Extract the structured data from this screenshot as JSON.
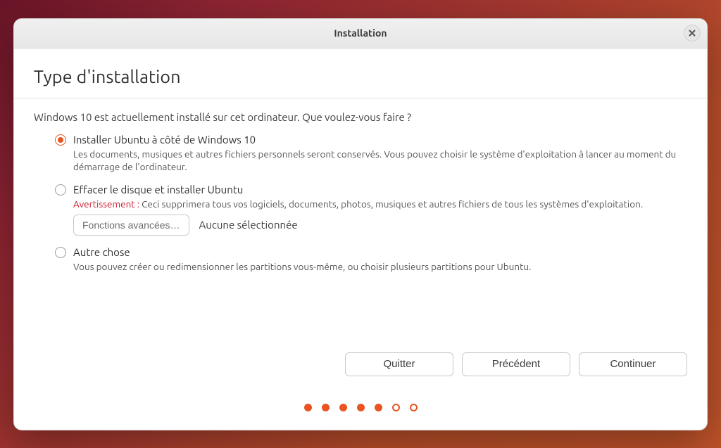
{
  "titlebar": {
    "title": "Installation"
  },
  "page_title": "Type d'installation",
  "prompt": "Windows 10 est actuellement installé sur cet ordinateur. Que voulez-vous faire ?",
  "options": [
    {
      "id": "alongside",
      "title": "Installer Ubuntu à côté de Windows 10",
      "description": "Les documents, musiques et autres fichiers personnels seront conservés. Vous pouvez choisir le système d'exploitation à lancer au moment du démarrage de l'ordinateur.",
      "selected": true
    },
    {
      "id": "erase",
      "title": "Effacer le disque et installer Ubuntu",
      "warning_label": "Avertissement :",
      "warning_text": "Ceci supprimera tous vos logiciels, documents, photos, musiques et autres fichiers de tous les systèmes d'exploitation.",
      "selected": false,
      "advanced_button": "Fonctions avancées…",
      "advanced_selection": "Aucune sélectionnée"
    },
    {
      "id": "something-else",
      "title": "Autre chose",
      "description": "Vous pouvez créer ou redimensionner les partitions vous-même, ou choisir plusieurs partitions pour Ubuntu.",
      "selected": false
    }
  ],
  "buttons": {
    "quit": "Quitter",
    "back": "Précédent",
    "continue": "Continuer"
  },
  "pager": {
    "total": 7,
    "filled": 5
  }
}
